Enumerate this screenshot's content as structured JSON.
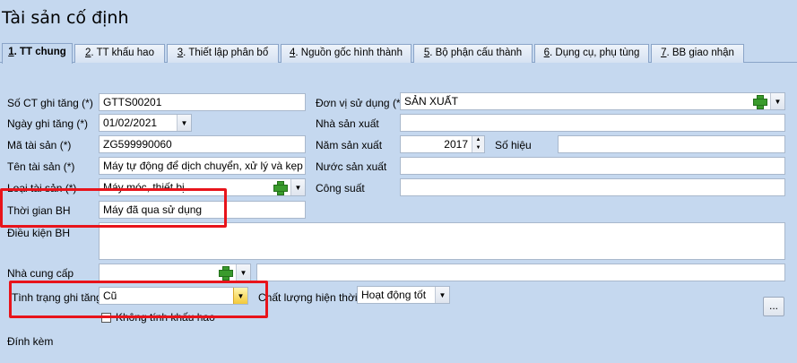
{
  "window": {
    "title": "Tài sản cố định"
  },
  "tabs": [
    {
      "key": "1",
      "label": ". TT chung"
    },
    {
      "key": "2",
      "label": ". TT khấu hao"
    },
    {
      "key": "3",
      "label": ". Thiết lập phân bổ"
    },
    {
      "key": "4",
      "label": ". Nguồn gốc hình thành"
    },
    {
      "key": "5",
      "label": ". Bộ phận cấu thành"
    },
    {
      "key": "6",
      "label": ". Dụng cụ, phụ tùng"
    },
    {
      "key": "7",
      "label": ". BB giao nhận"
    }
  ],
  "form": {
    "so_ct": {
      "label": "Số CT ghi tăng (*)",
      "value": "GTTS00201"
    },
    "ngay_ghi_tang": {
      "label": "Ngày ghi tăng (*)",
      "value": "01/02/2021"
    },
    "ma_tai_san": {
      "label": "Mã tài sản (*)",
      "value": "ZG599990060"
    },
    "ten_tai_san": {
      "label": "Tên tài sản (*)",
      "value": "Máy tự động để dịch chuyển, xử lý và kẹp gi"
    },
    "loai_tai_san": {
      "label": "Loại tài sản (*)",
      "value": "Máy móc, thiết bị"
    },
    "thoi_gian_bh": {
      "label": "Thời gian BH",
      "value": "Máy đã qua sử dụng"
    },
    "dieu_kien_bh": {
      "label": "Điều kiện BH",
      "value": ""
    },
    "nha_cung_cap": {
      "label": "Nhà cung cấp",
      "value": ""
    },
    "tinh_trang": {
      "label": "Tình trạng ghi tăng",
      "value": "Cũ"
    },
    "khong_tinh_khau_hao": {
      "label": "Không tính khấu hao",
      "checked": false
    },
    "dinh_kem": {
      "label": "Đính kèm"
    },
    "don_vi_su_dung": {
      "label": "Đơn vị sử dụng (*)",
      "value": "SẢN XUẤT"
    },
    "nha_san_xuat": {
      "label": "Nhà sản xuất",
      "value": ""
    },
    "nam_san_xuat": {
      "label": "Năm sản xuất",
      "value": "2017"
    },
    "so_hieu": {
      "label": "Số hiệu",
      "value": ""
    },
    "nuoc_san_xuat": {
      "label": "Nước sản xuất",
      "value": ""
    },
    "cong_suat": {
      "label": "Công suất",
      "value": ""
    },
    "chat_luong": {
      "label": "Chất lượng hiện thời",
      "value": "Hoạt động tốt"
    },
    "more_button": {
      "label": "..."
    }
  },
  "colors": {
    "background": "#c5d8ef",
    "highlight": "#e8141b",
    "plus": "#3a9b2c"
  }
}
